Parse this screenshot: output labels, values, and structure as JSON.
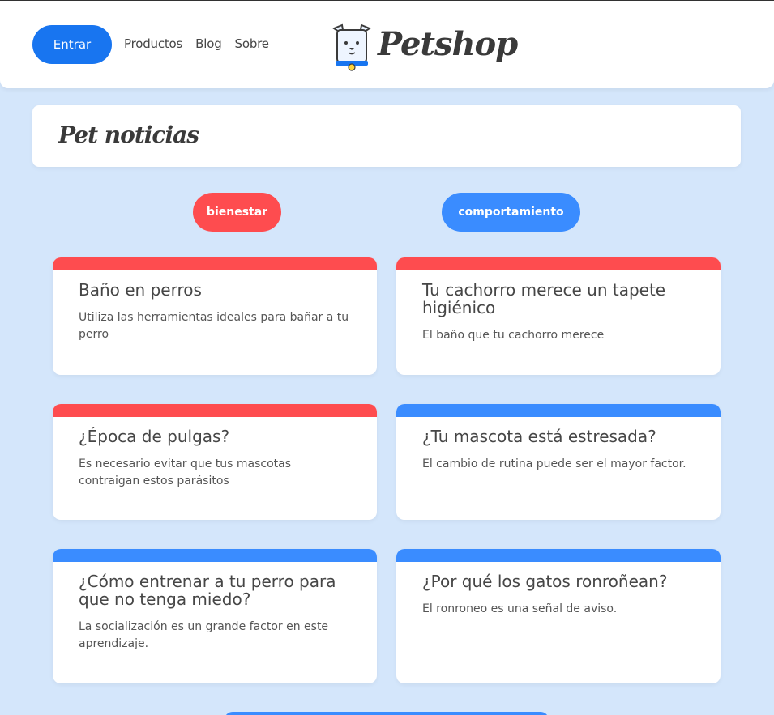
{
  "header": {
    "login_label": "Entrar",
    "nav": [
      "Productos",
      "Blog",
      "Sobre"
    ],
    "logo_text": "Petshop"
  },
  "section_title": "Pet noticias",
  "filters": [
    {
      "label": "bienestar",
      "color": "#fe4c4f"
    },
    {
      "label": "comportamiento",
      "color": "#3a8cff"
    }
  ],
  "colors": {
    "accent_blue": "#1875f0",
    "category_red": "#fe4c4f",
    "category_blue": "#3a8cff",
    "background": "#d4e6fb"
  },
  "posts": [
    {
      "title": "Baño en perros",
      "body": "Utiliza las herramientas ideales para bañar a tu perro",
      "category": "bienestar"
    },
    {
      "title": "Tu cachorro merece un tapete higiénico",
      "body": "El baño que tu cachorro merece",
      "category": "bienestar"
    },
    {
      "title": "¿Época de pulgas?",
      "body": "Es necesario evitar que tus mascotas contraigan estos parásitos",
      "category": "bienestar"
    },
    {
      "title": "¿Tu mascota está estresada?",
      "body": "El cambio de rutina puede ser el mayor factor.",
      "category": "comportamiento"
    },
    {
      "title": "¿Cómo entrenar a tu perro para que no tenga miedo?",
      "body": "La socialización es un grande factor en este aprendizaje.",
      "category": "comportamiento"
    },
    {
      "title": "¿Por qué los gatos ronroñean?",
      "body": "El ronroneo es una señal de aviso.",
      "category": "comportamiento"
    }
  ]
}
